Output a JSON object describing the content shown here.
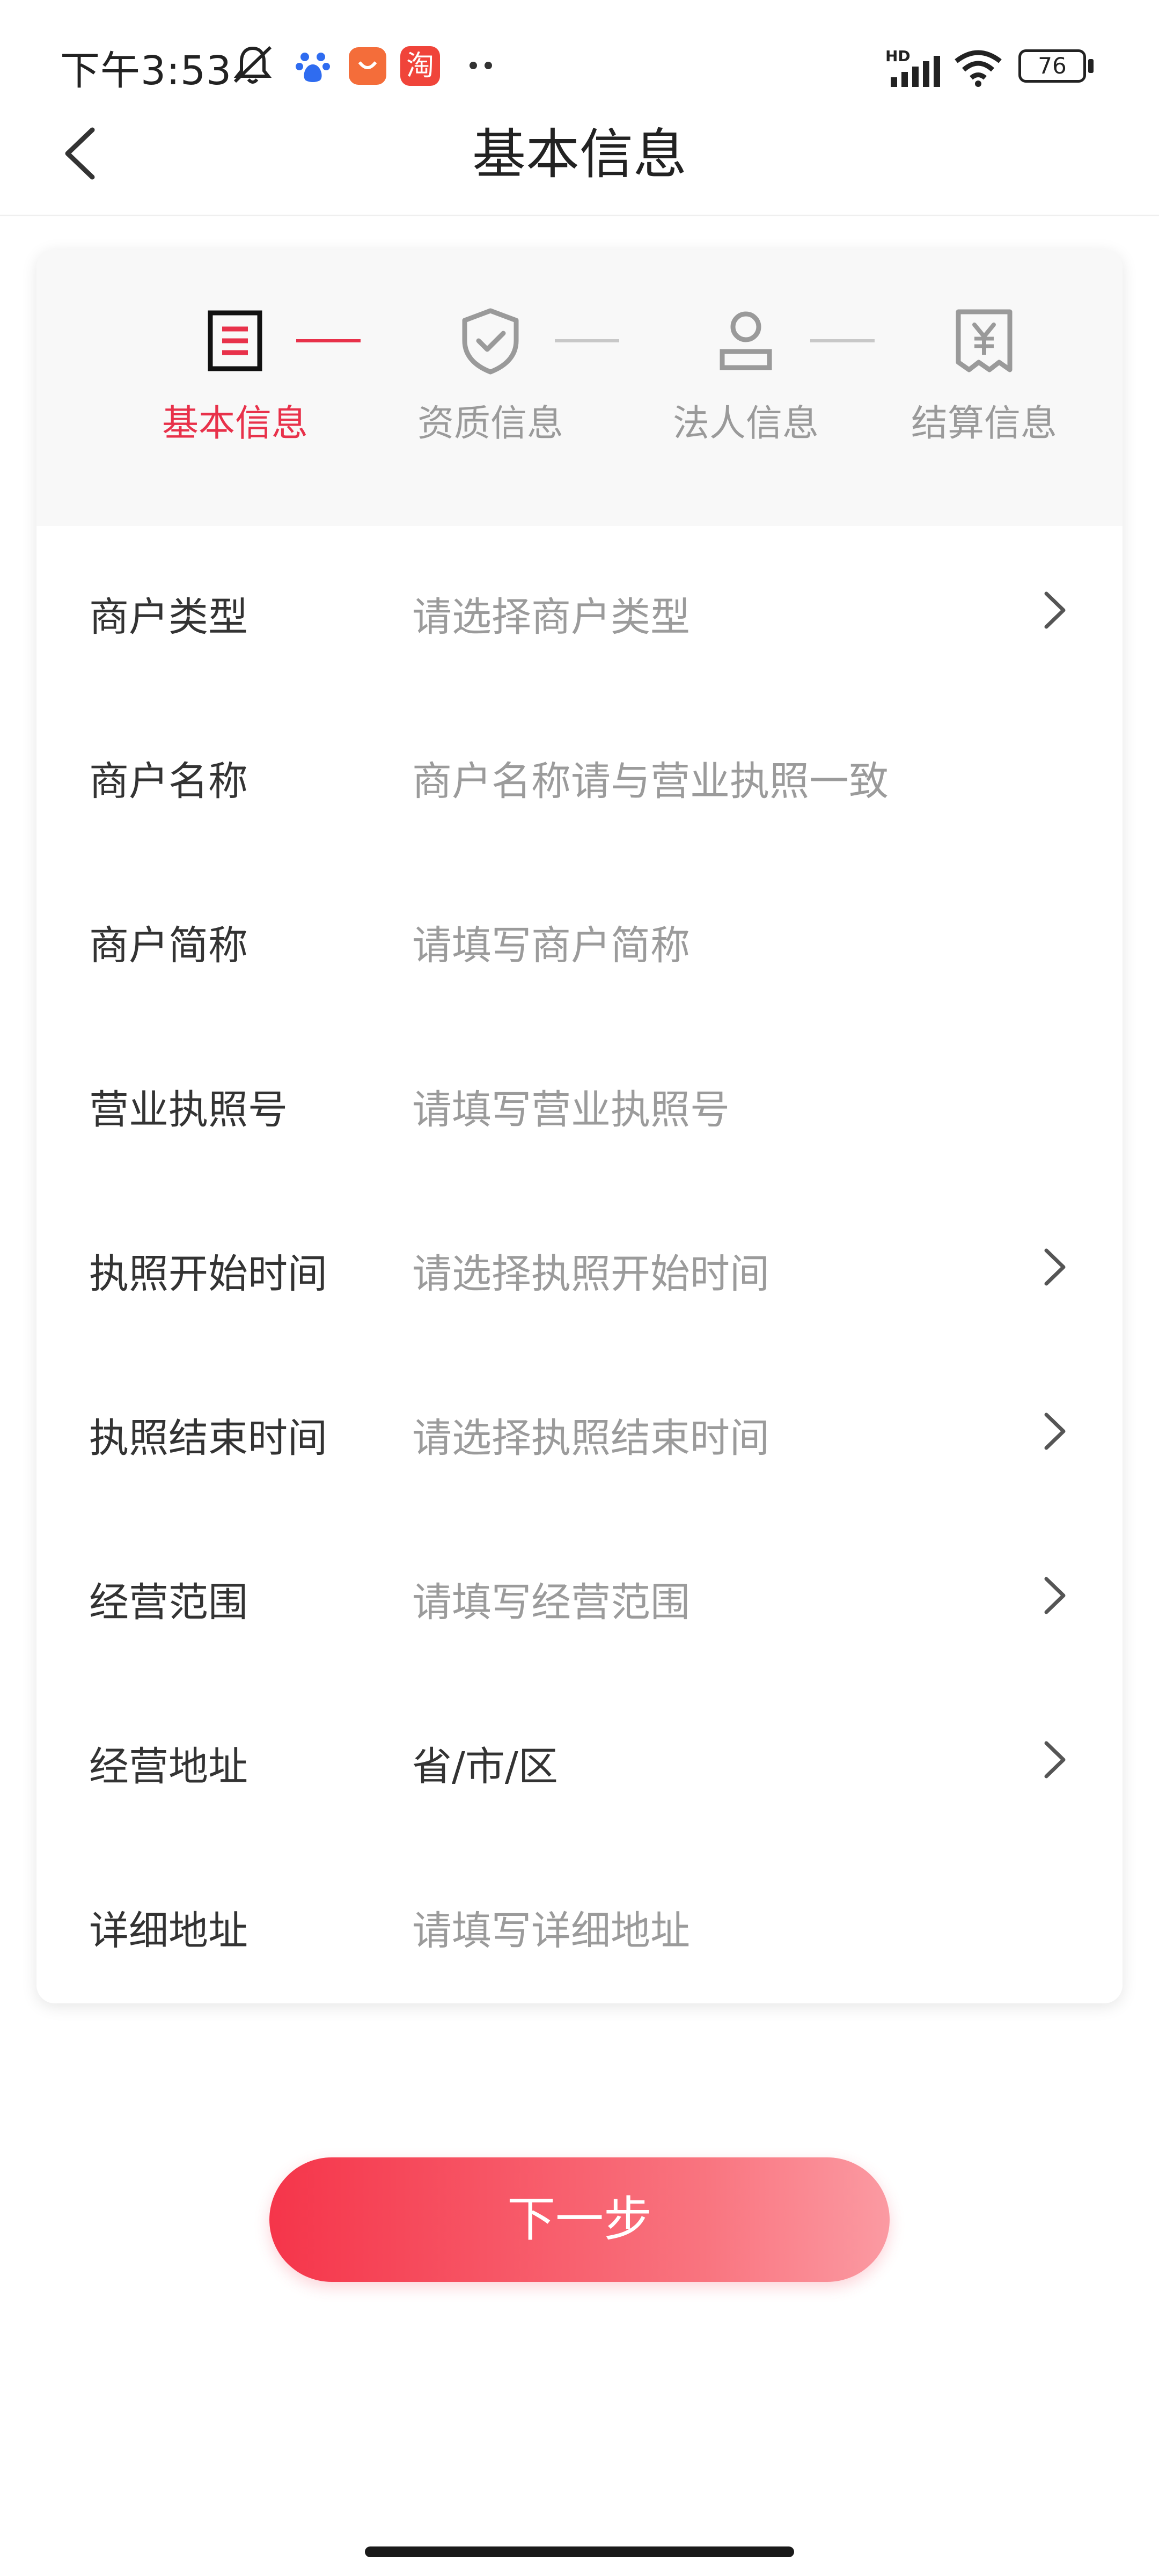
{
  "status_bar": {
    "time": "下午3:53",
    "network_tag": "HD",
    "battery": "76",
    "app_icon_labels": [
      "淘"
    ]
  },
  "header": {
    "title": "基本信息"
  },
  "steps": [
    {
      "label": "基本信息",
      "icon": "document-icon",
      "active": true
    },
    {
      "label": "资质信息",
      "icon": "shield-check-icon",
      "active": false
    },
    {
      "label": "法人信息",
      "icon": "person-icon",
      "active": false
    },
    {
      "label": "结算信息",
      "icon": "yuan-receipt-icon",
      "active": false
    }
  ],
  "form": {
    "rows": [
      {
        "label": "商户类型",
        "placeholder": "请选择商户类型",
        "chevron": true
      },
      {
        "label": "商户名称",
        "placeholder": "商户名称请与营业执照一致",
        "chevron": false
      },
      {
        "label": "商户简称",
        "placeholder": "请填写商户简称",
        "chevron": false
      },
      {
        "label": "营业执照号",
        "placeholder": "请填写营业执照号",
        "chevron": false
      },
      {
        "label": "执照开始时间",
        "placeholder": "请选择执照开始时间",
        "chevron": true
      },
      {
        "label": "执照结束时间",
        "placeholder": "请选择执照结束时间",
        "chevron": true
      },
      {
        "label": "经营范围",
        "placeholder": "请填写经营范围",
        "chevron": true
      },
      {
        "label": "经营地址",
        "value": "省/市/区",
        "chevron": true
      },
      {
        "label": "详细地址",
        "placeholder": "请填写详细地址",
        "chevron": false
      }
    ]
  },
  "next_button": {
    "label": "下一步"
  },
  "colors": {
    "accent": "#e8314a",
    "button_gradient_start": "#f5354a",
    "button_gradient_end": "#fb9aa2",
    "label": "#333333",
    "placeholder": "#9b9b9b"
  }
}
